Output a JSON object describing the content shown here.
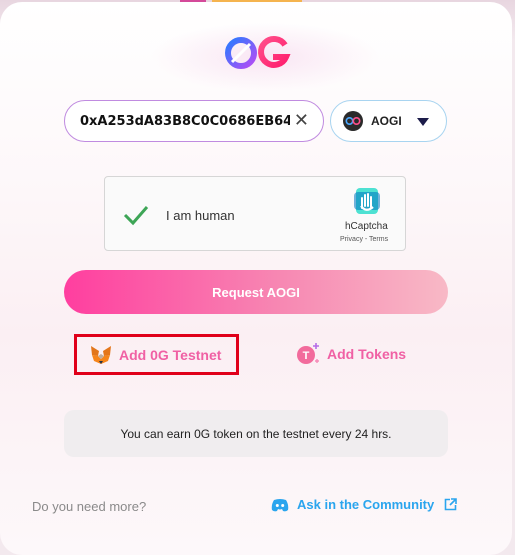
{
  "brand": {
    "logo": "0g-logo",
    "colors": {
      "pink": "#ff3e9f",
      "blue": "#2aa5ee",
      "red": "#e0001a"
    }
  },
  "form": {
    "address_value": "0xA253dA83B8C0C0686EB64",
    "clear_icon": "close-icon",
    "token": {
      "label": "AOGI",
      "icon": "0g-token-icon",
      "caret_icon": "caret-down-icon"
    }
  },
  "captcha": {
    "label": "I am human",
    "brand": "hCaptcha",
    "links": "Privacy - Terms",
    "check_icon": "checkmark-icon"
  },
  "request_button": {
    "label": "Request AOGI"
  },
  "add_network": {
    "label": "Add 0G Testnet",
    "icon": "metamask-fox-icon"
  },
  "add_tokens": {
    "label": "Add Tokens",
    "icon": "token-plus-icon"
  },
  "info": {
    "text": "You can earn 0G token on the testnet every 24 hrs."
  },
  "footer": {
    "question": "Do you need more?",
    "community_label": "Ask in the Community",
    "discord_icon": "discord-icon",
    "external_icon": "external-link-icon"
  }
}
